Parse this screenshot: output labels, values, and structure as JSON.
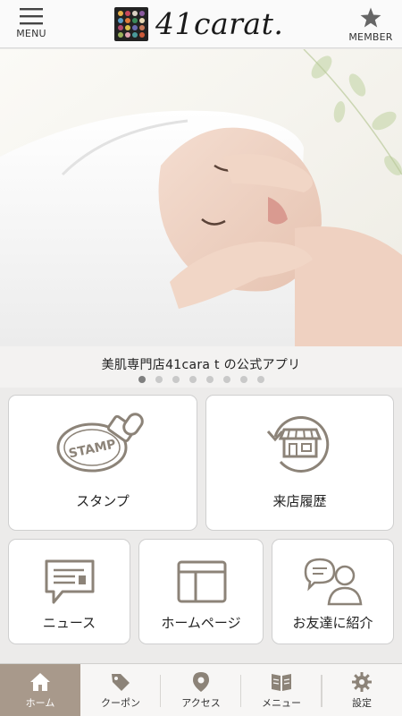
{
  "header": {
    "menu_label": "MENU",
    "member_label": "MEMBER",
    "logo_text": "41carat."
  },
  "hero": {
    "caption": "美肌専門店41cara t の公式アプリ",
    "slide_count": 8,
    "active_slide": 1
  },
  "tiles": {
    "stamp": "スタンプ",
    "history": "来店履歴",
    "news": "ニュース",
    "homepage": "ホームページ",
    "refer": "お友達に紹介"
  },
  "bottom_nav": {
    "items": [
      {
        "label": "ホーム",
        "icon": "home-icon",
        "active": true
      },
      {
        "label": "クーポン",
        "icon": "coupon-tag-icon",
        "active": false
      },
      {
        "label": "アクセス",
        "icon": "map-pin-icon",
        "active": false
      },
      {
        "label": "メニュー",
        "icon": "book-icon",
        "active": false
      },
      {
        "label": "設定",
        "icon": "gear-icon",
        "active": false
      }
    ]
  },
  "colors": {
    "active_nav": "#a8998b",
    "icon_gray": "#8c8378",
    "background": "#ecebea"
  }
}
